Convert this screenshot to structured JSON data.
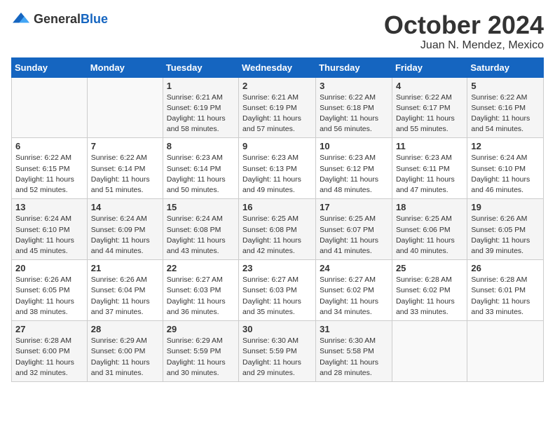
{
  "header": {
    "logo_general": "General",
    "logo_blue": "Blue",
    "month_title": "October 2024",
    "location": "Juan N. Mendez, Mexico"
  },
  "weekdays": [
    "Sunday",
    "Monday",
    "Tuesday",
    "Wednesday",
    "Thursday",
    "Friday",
    "Saturday"
  ],
  "weeks": [
    [
      {
        "day": "",
        "sunrise": "",
        "sunset": "",
        "daylight": ""
      },
      {
        "day": "",
        "sunrise": "",
        "sunset": "",
        "daylight": ""
      },
      {
        "day": "1",
        "sunrise": "Sunrise: 6:21 AM",
        "sunset": "Sunset: 6:19 PM",
        "daylight": "Daylight: 11 hours and 58 minutes."
      },
      {
        "day": "2",
        "sunrise": "Sunrise: 6:21 AM",
        "sunset": "Sunset: 6:19 PM",
        "daylight": "Daylight: 11 hours and 57 minutes."
      },
      {
        "day": "3",
        "sunrise": "Sunrise: 6:22 AM",
        "sunset": "Sunset: 6:18 PM",
        "daylight": "Daylight: 11 hours and 56 minutes."
      },
      {
        "day": "4",
        "sunrise": "Sunrise: 6:22 AM",
        "sunset": "Sunset: 6:17 PM",
        "daylight": "Daylight: 11 hours and 55 minutes."
      },
      {
        "day": "5",
        "sunrise": "Sunrise: 6:22 AM",
        "sunset": "Sunset: 6:16 PM",
        "daylight": "Daylight: 11 hours and 54 minutes."
      }
    ],
    [
      {
        "day": "6",
        "sunrise": "Sunrise: 6:22 AM",
        "sunset": "Sunset: 6:15 PM",
        "daylight": "Daylight: 11 hours and 52 minutes."
      },
      {
        "day": "7",
        "sunrise": "Sunrise: 6:22 AM",
        "sunset": "Sunset: 6:14 PM",
        "daylight": "Daylight: 11 hours and 51 minutes."
      },
      {
        "day": "8",
        "sunrise": "Sunrise: 6:23 AM",
        "sunset": "Sunset: 6:14 PM",
        "daylight": "Daylight: 11 hours and 50 minutes."
      },
      {
        "day": "9",
        "sunrise": "Sunrise: 6:23 AM",
        "sunset": "Sunset: 6:13 PM",
        "daylight": "Daylight: 11 hours and 49 minutes."
      },
      {
        "day": "10",
        "sunrise": "Sunrise: 6:23 AM",
        "sunset": "Sunset: 6:12 PM",
        "daylight": "Daylight: 11 hours and 48 minutes."
      },
      {
        "day": "11",
        "sunrise": "Sunrise: 6:23 AM",
        "sunset": "Sunset: 6:11 PM",
        "daylight": "Daylight: 11 hours and 47 minutes."
      },
      {
        "day": "12",
        "sunrise": "Sunrise: 6:24 AM",
        "sunset": "Sunset: 6:10 PM",
        "daylight": "Daylight: 11 hours and 46 minutes."
      }
    ],
    [
      {
        "day": "13",
        "sunrise": "Sunrise: 6:24 AM",
        "sunset": "Sunset: 6:10 PM",
        "daylight": "Daylight: 11 hours and 45 minutes."
      },
      {
        "day": "14",
        "sunrise": "Sunrise: 6:24 AM",
        "sunset": "Sunset: 6:09 PM",
        "daylight": "Daylight: 11 hours and 44 minutes."
      },
      {
        "day": "15",
        "sunrise": "Sunrise: 6:24 AM",
        "sunset": "Sunset: 6:08 PM",
        "daylight": "Daylight: 11 hours and 43 minutes."
      },
      {
        "day": "16",
        "sunrise": "Sunrise: 6:25 AM",
        "sunset": "Sunset: 6:08 PM",
        "daylight": "Daylight: 11 hours and 42 minutes."
      },
      {
        "day": "17",
        "sunrise": "Sunrise: 6:25 AM",
        "sunset": "Sunset: 6:07 PM",
        "daylight": "Daylight: 11 hours and 41 minutes."
      },
      {
        "day": "18",
        "sunrise": "Sunrise: 6:25 AM",
        "sunset": "Sunset: 6:06 PM",
        "daylight": "Daylight: 11 hours and 40 minutes."
      },
      {
        "day": "19",
        "sunrise": "Sunrise: 6:26 AM",
        "sunset": "Sunset: 6:05 PM",
        "daylight": "Daylight: 11 hours and 39 minutes."
      }
    ],
    [
      {
        "day": "20",
        "sunrise": "Sunrise: 6:26 AM",
        "sunset": "Sunset: 6:05 PM",
        "daylight": "Daylight: 11 hours and 38 minutes."
      },
      {
        "day": "21",
        "sunrise": "Sunrise: 6:26 AM",
        "sunset": "Sunset: 6:04 PM",
        "daylight": "Daylight: 11 hours and 37 minutes."
      },
      {
        "day": "22",
        "sunrise": "Sunrise: 6:27 AM",
        "sunset": "Sunset: 6:03 PM",
        "daylight": "Daylight: 11 hours and 36 minutes."
      },
      {
        "day": "23",
        "sunrise": "Sunrise: 6:27 AM",
        "sunset": "Sunset: 6:03 PM",
        "daylight": "Daylight: 11 hours and 35 minutes."
      },
      {
        "day": "24",
        "sunrise": "Sunrise: 6:27 AM",
        "sunset": "Sunset: 6:02 PM",
        "daylight": "Daylight: 11 hours and 34 minutes."
      },
      {
        "day": "25",
        "sunrise": "Sunrise: 6:28 AM",
        "sunset": "Sunset: 6:02 PM",
        "daylight": "Daylight: 11 hours and 33 minutes."
      },
      {
        "day": "26",
        "sunrise": "Sunrise: 6:28 AM",
        "sunset": "Sunset: 6:01 PM",
        "daylight": "Daylight: 11 hours and 33 minutes."
      }
    ],
    [
      {
        "day": "27",
        "sunrise": "Sunrise: 6:28 AM",
        "sunset": "Sunset: 6:00 PM",
        "daylight": "Daylight: 11 hours and 32 minutes."
      },
      {
        "day": "28",
        "sunrise": "Sunrise: 6:29 AM",
        "sunset": "Sunset: 6:00 PM",
        "daylight": "Daylight: 11 hours and 31 minutes."
      },
      {
        "day": "29",
        "sunrise": "Sunrise: 6:29 AM",
        "sunset": "Sunset: 5:59 PM",
        "daylight": "Daylight: 11 hours and 30 minutes."
      },
      {
        "day": "30",
        "sunrise": "Sunrise: 6:30 AM",
        "sunset": "Sunset: 5:59 PM",
        "daylight": "Daylight: 11 hours and 29 minutes."
      },
      {
        "day": "31",
        "sunrise": "Sunrise: 6:30 AM",
        "sunset": "Sunset: 5:58 PM",
        "daylight": "Daylight: 11 hours and 28 minutes."
      },
      {
        "day": "",
        "sunrise": "",
        "sunset": "",
        "daylight": ""
      },
      {
        "day": "",
        "sunrise": "",
        "sunset": "",
        "daylight": ""
      }
    ]
  ]
}
